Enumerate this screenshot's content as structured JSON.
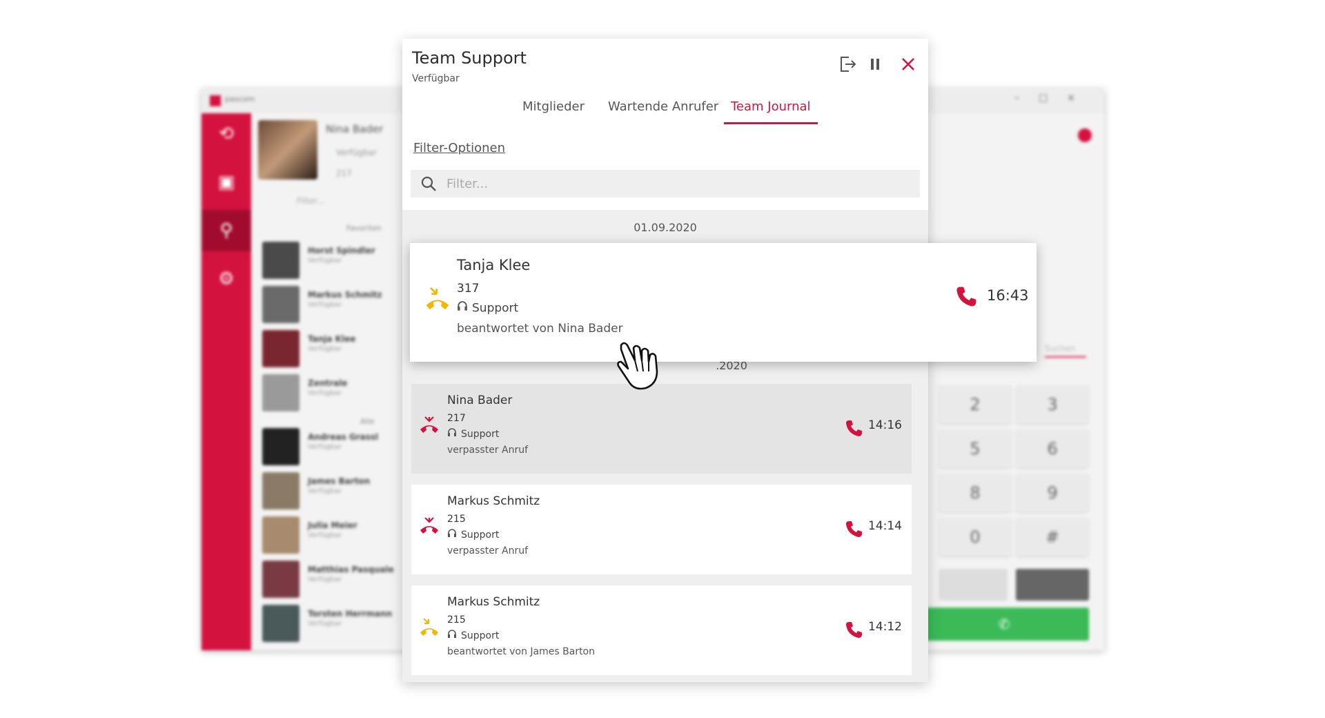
{
  "background_app": {
    "logo_text": "pascom",
    "profile": {
      "name": "Nina Bader",
      "status": "Verfügbar",
      "extension": "217"
    },
    "search_placeholder": "Filter...",
    "favorites_label": "Favoriten",
    "all_label": "Alle",
    "contacts": [
      {
        "name": "Horst Spindler",
        "status": "Verfügbar"
      },
      {
        "name": "Markus Schmitz",
        "status": "Verfügbar"
      },
      {
        "name": "Tanja Klee",
        "status": "Verfügbar"
      },
      {
        "name": "Zentrale",
        "status": "Verfügbar"
      },
      {
        "name": "Andreas Grassl",
        "status": "Verfügbar"
      },
      {
        "name": "James Barton",
        "status": "Verfügbar"
      },
      {
        "name": "Julia Meier",
        "status": "Verfügbar"
      },
      {
        "name": "Matthias Pasquale",
        "status": "Verfügbar"
      },
      {
        "name": "Torsten Herrmann",
        "status": "Verfügbar"
      }
    ],
    "dialpad": [
      "2",
      "3",
      "5",
      "6",
      "8",
      "9",
      "0",
      "#"
    ],
    "search_right": "Suchen"
  },
  "dialog": {
    "title": "Team Support",
    "status": "Verfügbar",
    "tabs": [
      "Mitglieder",
      "Wartende Anrufer",
      "Team Journal"
    ],
    "active_tab": "Team Journal",
    "filter_link": "Filter-Optionen",
    "search_placeholder": "Filter...",
    "date_top": "01.09.2020",
    "date_partial": ".2020"
  },
  "highlight": {
    "name": "Tanja Klee",
    "extension": "317",
    "team": "Support",
    "info": "beantwortet von Nina Bader",
    "time": "16:43",
    "type": "answered"
  },
  "entries": [
    {
      "name": "Nina Bader",
      "extension": "217",
      "team": "Support",
      "info": "verpasster Anruf",
      "time": "14:16",
      "type": "missed"
    },
    {
      "name": "Markus Schmitz",
      "extension": "215",
      "team": "Support",
      "info": "verpasster Anruf",
      "time": "14:14",
      "type": "missed"
    },
    {
      "name": "Markus Schmitz",
      "extension": "215",
      "team": "Support",
      "info": "beantwortet von James Barton",
      "time": "14:12",
      "type": "answered"
    }
  ],
  "colors": {
    "accent": "#d3123e",
    "answered": "#f2b705",
    "call_green": "#3bba57"
  }
}
